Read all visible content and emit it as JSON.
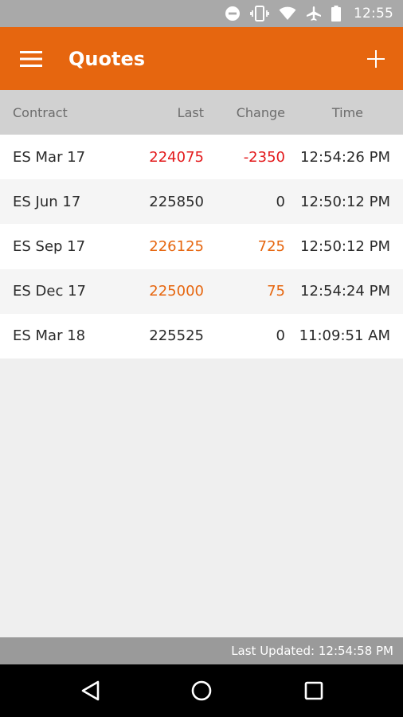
{
  "status_bar": {
    "time": "12:55",
    "icons": [
      "do-not-disturb-icon",
      "vibrate-icon",
      "wifi-icon",
      "airplane-icon",
      "battery-icon"
    ]
  },
  "app_bar": {
    "title": "Quotes",
    "menu_icon": "hamburger-menu-icon",
    "add_icon": "plus-icon",
    "color": "#e6660f"
  },
  "table": {
    "headers": {
      "contract": "Contract",
      "last": "Last",
      "change": "Change",
      "time": "Time"
    },
    "rows": [
      {
        "contract": "ES Mar 17",
        "last": "224075",
        "change": "-2350",
        "time": "12:54:26 PM",
        "status": "down"
      },
      {
        "contract": "ES Jun 17",
        "last": "225850",
        "change": "0",
        "time": "12:50:12 PM",
        "status": "unchanged"
      },
      {
        "contract": "ES Sep 17",
        "last": "226125",
        "change": "725",
        "time": "12:50:12 PM",
        "status": "up"
      },
      {
        "contract": "ES Dec 17",
        "last": "225000",
        "change": "75",
        "time": "12:54:24 PM",
        "status": "up"
      },
      {
        "contract": "ES Mar 18",
        "last": "225525",
        "change": "0",
        "time": "11:09:51 AM",
        "status": "unchanged"
      }
    ]
  },
  "colors": {
    "down": "#e3191b",
    "up": "#e6660f",
    "unchanged": "#2a2a2a"
  },
  "footer": {
    "last_updated": "Last Updated: 12:54:58 PM"
  },
  "nav_bar": {
    "icons": [
      "back-icon",
      "home-icon",
      "recents-icon"
    ]
  }
}
